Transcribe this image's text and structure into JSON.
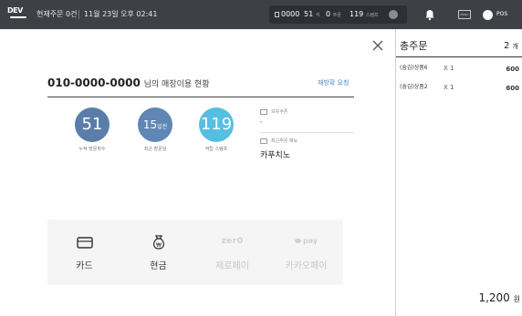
{
  "topbar": {
    "logo_text": "DEV",
    "order_status": "현재주문 0건",
    "datetime": "11월 23일 오후 02:41",
    "stats": {
      "tables_value": "0000",
      "seats_value": "51",
      "seats_unit": "석",
      "orders_value": "0",
      "orders_unit": "주문",
      "stamps_value": "119",
      "stamps_unit": "스탬프"
    },
    "tv_label": "MENU",
    "pos_label": "POS"
  },
  "customer": {
    "phone": "010-0000-0000",
    "title_suffix": "님의 매장이용 현황",
    "request_link": "재방확 요청"
  },
  "metrics": [
    {
      "value": "51",
      "unit": "",
      "label": "누적 방문횟수",
      "color": "#5a7ea9"
    },
    {
      "value": "15",
      "unit": "일전",
      "label": "최근 방문일",
      "color": "#5f86b5"
    },
    {
      "value": "119",
      "unit": "",
      "label": "적립 스탬프",
      "color": "#55bfe3"
    }
  ],
  "coupon": {
    "label": "보유쿠폰",
    "value": "-"
  },
  "recent_menu": {
    "label": "최근주문 메뉴",
    "value": "카푸치노"
  },
  "payment_methods": [
    {
      "label": "카드",
      "icon": "card-icon",
      "enabled": true
    },
    {
      "label": "현금",
      "icon": "cash-bag-icon",
      "enabled": true
    },
    {
      "label": "제로페이",
      "logo": "zer0",
      "icon": "zeropay-logo",
      "enabled": false
    },
    {
      "label": "카카오페이",
      "logo": "pay",
      "icon": "kakaopay-logo",
      "enabled": false
    }
  ],
  "order_panel": {
    "title": "총주문",
    "count": "2",
    "count_unit": "개",
    "items": [
      {
        "name": "(숨김)상품6",
        "qty": "X 1",
        "price": "600"
      },
      {
        "name": "(숨김)상품2",
        "qty": "X 1",
        "price": "600"
      }
    ],
    "total": "1,200",
    "total_unit": "원"
  },
  "colors": {
    "topbar_bg": "#3f4046",
    "circle_dark": "#5a7ea9",
    "circle_light": "#55bfe3",
    "link": "#4a86c5"
  }
}
